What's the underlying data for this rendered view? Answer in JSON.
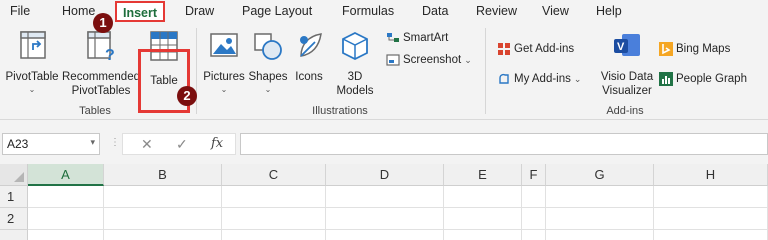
{
  "tabs": [
    {
      "id": "file",
      "label": "File"
    },
    {
      "id": "home",
      "label": "Home"
    },
    {
      "id": "insert",
      "label": "Insert"
    },
    {
      "id": "draw",
      "label": "Draw"
    },
    {
      "id": "page_layout",
      "label": "Page Layout"
    },
    {
      "id": "formulas",
      "label": "Formulas"
    },
    {
      "id": "data",
      "label": "Data"
    },
    {
      "id": "review",
      "label": "Review"
    },
    {
      "id": "view",
      "label": "View"
    },
    {
      "id": "help",
      "label": "Help"
    }
  ],
  "badges": {
    "one": "1",
    "two": "2"
  },
  "ribbon": {
    "tables": {
      "group_label": "Tables",
      "pivot_table": "PivotTable",
      "recommended_line1": "Recommended",
      "recommended_line2": "PivotTables",
      "table": "Table"
    },
    "illustrations": {
      "group_label": "Illustrations",
      "pictures": "Pictures",
      "shapes": "Shapes",
      "icons": "Icons",
      "models_line1": "3D",
      "models_line2": "Models",
      "smartart": "SmartArt",
      "screenshot": "Screenshot"
    },
    "addins": {
      "group_label": "Add-ins",
      "get_addins": "Get Add-ins",
      "my_addins": "My Add-ins",
      "visio_line1": "Visio Data",
      "visio_line2": "Visualizer",
      "bing_maps": "Bing Maps",
      "people_graph": "People Graph"
    },
    "accent_color": "#217346",
    "highlight_color": "#e53935"
  },
  "formula_bar": {
    "name_box": "A23",
    "fx": "fx",
    "cancel": "✕",
    "enter": "✓",
    "value": ""
  },
  "sheet": {
    "columns": [
      "A",
      "B",
      "C",
      "D",
      "E",
      "F",
      "G",
      "H"
    ],
    "rows": [
      "1",
      "2"
    ],
    "selected_column": "A"
  }
}
